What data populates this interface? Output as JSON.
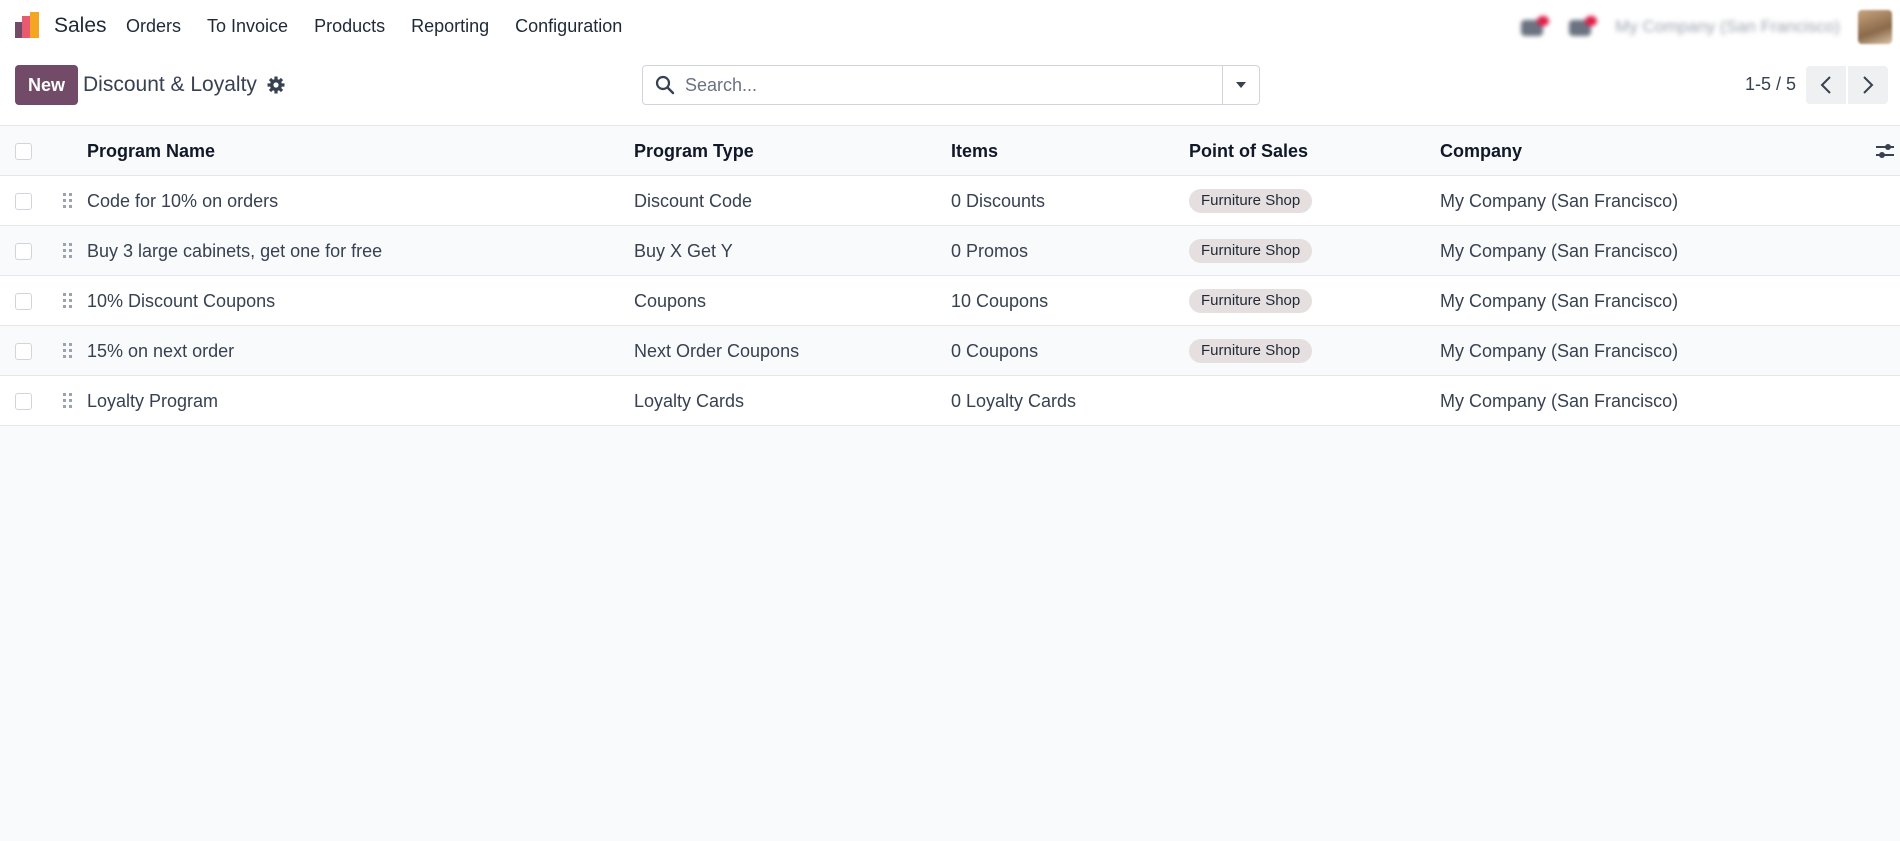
{
  "navbar": {
    "app_name": "Sales",
    "menu": [
      "Orders",
      "To Invoice",
      "Products",
      "Reporting",
      "Configuration"
    ],
    "company_name": "My Company (San Francisco)",
    "brand_color": "#714b67"
  },
  "control": {
    "new_label": "New",
    "breadcrumb": "Discount & Loyalty",
    "search_placeholder": "Search...",
    "pager_value": "1-5 / 5"
  },
  "table": {
    "headers": {
      "name": "Program Name",
      "type": "Program Type",
      "items": "Items",
      "pos": "Point of Sales",
      "company": "Company"
    },
    "rows": [
      {
        "name": "Code for 10% on orders",
        "type": "Discount Code",
        "items": "0 Discounts",
        "pos": "Furniture Shop",
        "company": "My Company (San Francisco)"
      },
      {
        "name": "Buy 3 large cabinets, get one for free",
        "type": "Buy X Get Y",
        "items": "0 Promos",
        "pos": "Furniture Shop",
        "company": "My Company (San Francisco)"
      },
      {
        "name": "10% Discount Coupons",
        "type": "Coupons",
        "items": "10 Coupons",
        "pos": "Furniture Shop",
        "company": "My Company (San Francisco)"
      },
      {
        "name": "15% on next order",
        "type": "Next Order Coupons",
        "items": "0 Coupons",
        "pos": "Furniture Shop",
        "company": "My Company (San Francisco)"
      },
      {
        "name": "Loyalty Program",
        "type": "Loyalty Cards",
        "items": "0 Loyalty Cards",
        "pos": "",
        "company": "My Company (San Francisco)"
      }
    ]
  }
}
